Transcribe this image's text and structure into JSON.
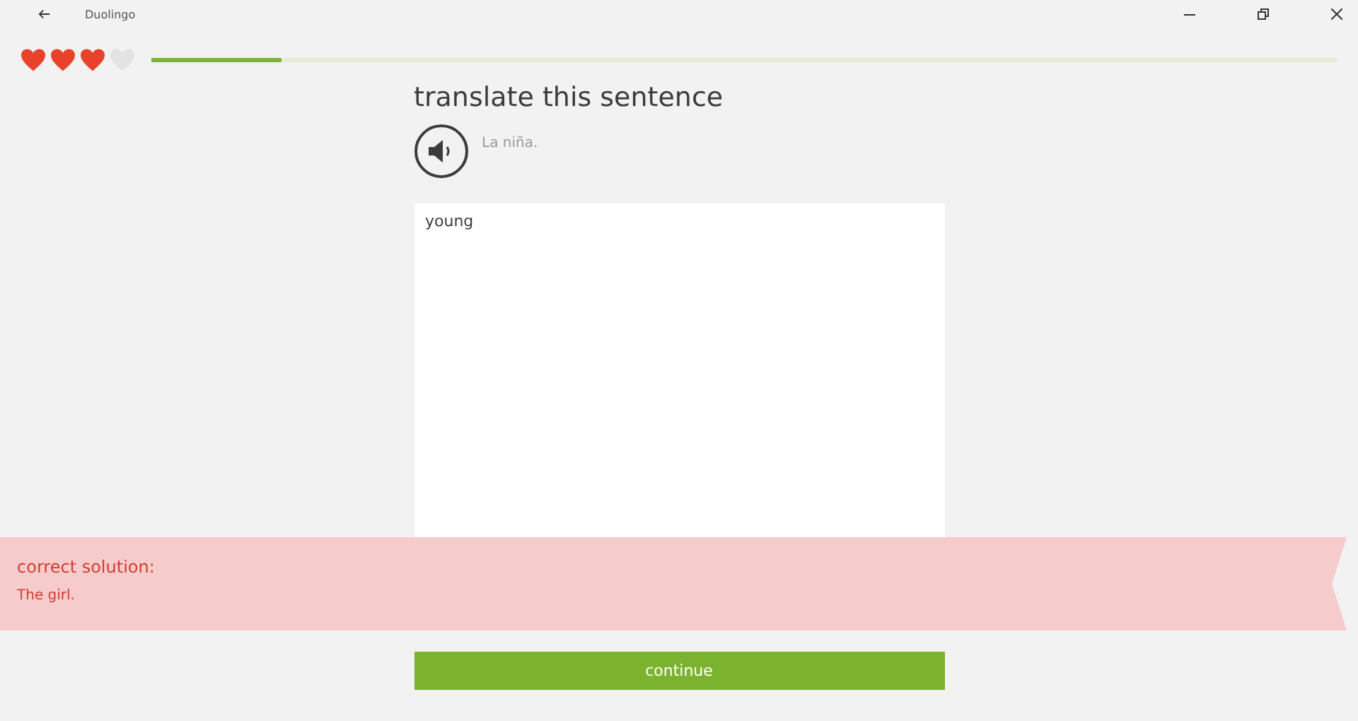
{
  "window": {
    "title": "Duolingo"
  },
  "hearts": [
    {
      "filled": true
    },
    {
      "filled": true
    },
    {
      "filled": true
    },
    {
      "filled": false
    }
  ],
  "progress": {
    "level": 0.11
  },
  "prompt": {
    "title": "translate this sentence",
    "sentence": "La niña."
  },
  "answer": {
    "value": "young"
  },
  "feedback": {
    "heading": "correct solution:",
    "solution": "The girl."
  },
  "continue_button": "continue"
}
